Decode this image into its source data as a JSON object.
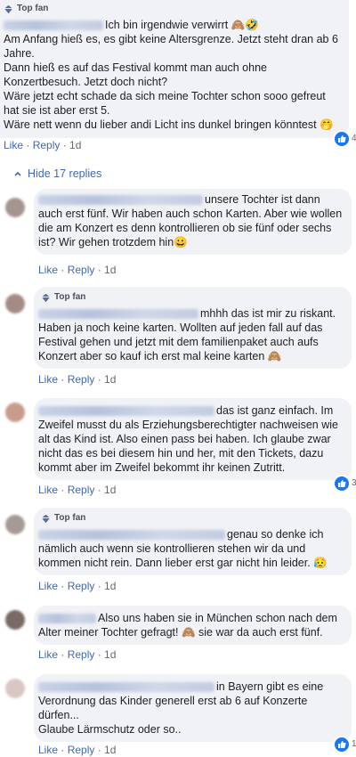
{
  "main_comment": {
    "badge": "Top fan",
    "lines": [
      "Ich bin irgendwie verwirrt 🙈🤣",
      "Am Anfang hieß es, es gibt keine Altersgrenze. Jetzt steht dran ab 6 Jahre.",
      "Dann hieß es auf das Festival kommt man auch ohne Konzertbesuch. Jetzt doch nicht?",
      "Wäre jetzt echt schade da sich meine Tochter schon sooo gefreut hat sie ist aber erst 5.",
      "Wäre nett wenn du lieber andi Licht ins dunkel bringen könntest 🤭"
    ],
    "like": "Like",
    "reply": "Reply",
    "time": "1d",
    "reaction_count": "4"
  },
  "hide_replies": "Hide 17 replies",
  "replies": [
    {
      "badge": "",
      "text": "unsere Tochter ist dann auch erst fünf. Wir haben auch schon Karten. Aber wie wollen die am Konzert es denn kontrollieren ob sie fünf oder sechs ist? Wir gehen trotzdem hin😀",
      "like": "Like",
      "reply": "Reply",
      "time": "1d",
      "reaction_count": ""
    },
    {
      "badge": "Top fan",
      "text": "mhhh das ist mir zu riskant. Haben ja noch keine karten. Wollten auf jeden fall auf das Festival gehen und jetzt mit dem familienpaket auch aufs Konzert aber so kauf ich erst mal keine karten 🙈",
      "like": "Like",
      "reply": "Reply",
      "time": "1d",
      "reaction_count": ""
    },
    {
      "badge": "",
      "text": "das ist ganz einfach. Im Zweifel musst du als Erziehungsberechtigter nachweisen wie alt das Kind ist. Also einen pass bei haben. Ich glaube zwar nicht das es bei diesem hin und her, mit den Tickets, dazu kommt aber im Zweifel bekommt ihr keinen Zutritt.",
      "like": "Like",
      "reply": "Reply",
      "time": "1d",
      "reaction_count": "3"
    },
    {
      "badge": "Top fan",
      "text": "genau so denke ich nämlich auch wenn sie kontrollieren stehen wir da und kommen nicht rein. Dann lieber erst gar nicht hin leider. 😥",
      "like": "Like",
      "reply": "Reply",
      "time": "1d",
      "reaction_count": ""
    },
    {
      "badge": "",
      "text": "Also uns haben sie in München schon nach dem Alter meiner Tochter gefragt! 🙈 sie war da auch erst fünf.",
      "like": "Like",
      "reply": "Reply",
      "time": "1d",
      "reaction_count": ""
    },
    {
      "badge": "",
      "text": "in Bayern gibt es eine Verordnung das Kinder generell erst ab 6 auf Konzerte dürfen...",
      "text2": "Glaube Lärmschutz oder so..",
      "like": "Like",
      "reply": "Reply",
      "time": "1d",
      "reaction_count": "1"
    }
  ],
  "icons": {
    "top_fan": "diamond-badge-icon",
    "like_reaction": "thumbs-up-icon",
    "collapse": "chevron-up-icon"
  },
  "colors": {
    "link": "#4267b2",
    "reaction": "#1877f2",
    "bubble": "#f0f2f5"
  }
}
